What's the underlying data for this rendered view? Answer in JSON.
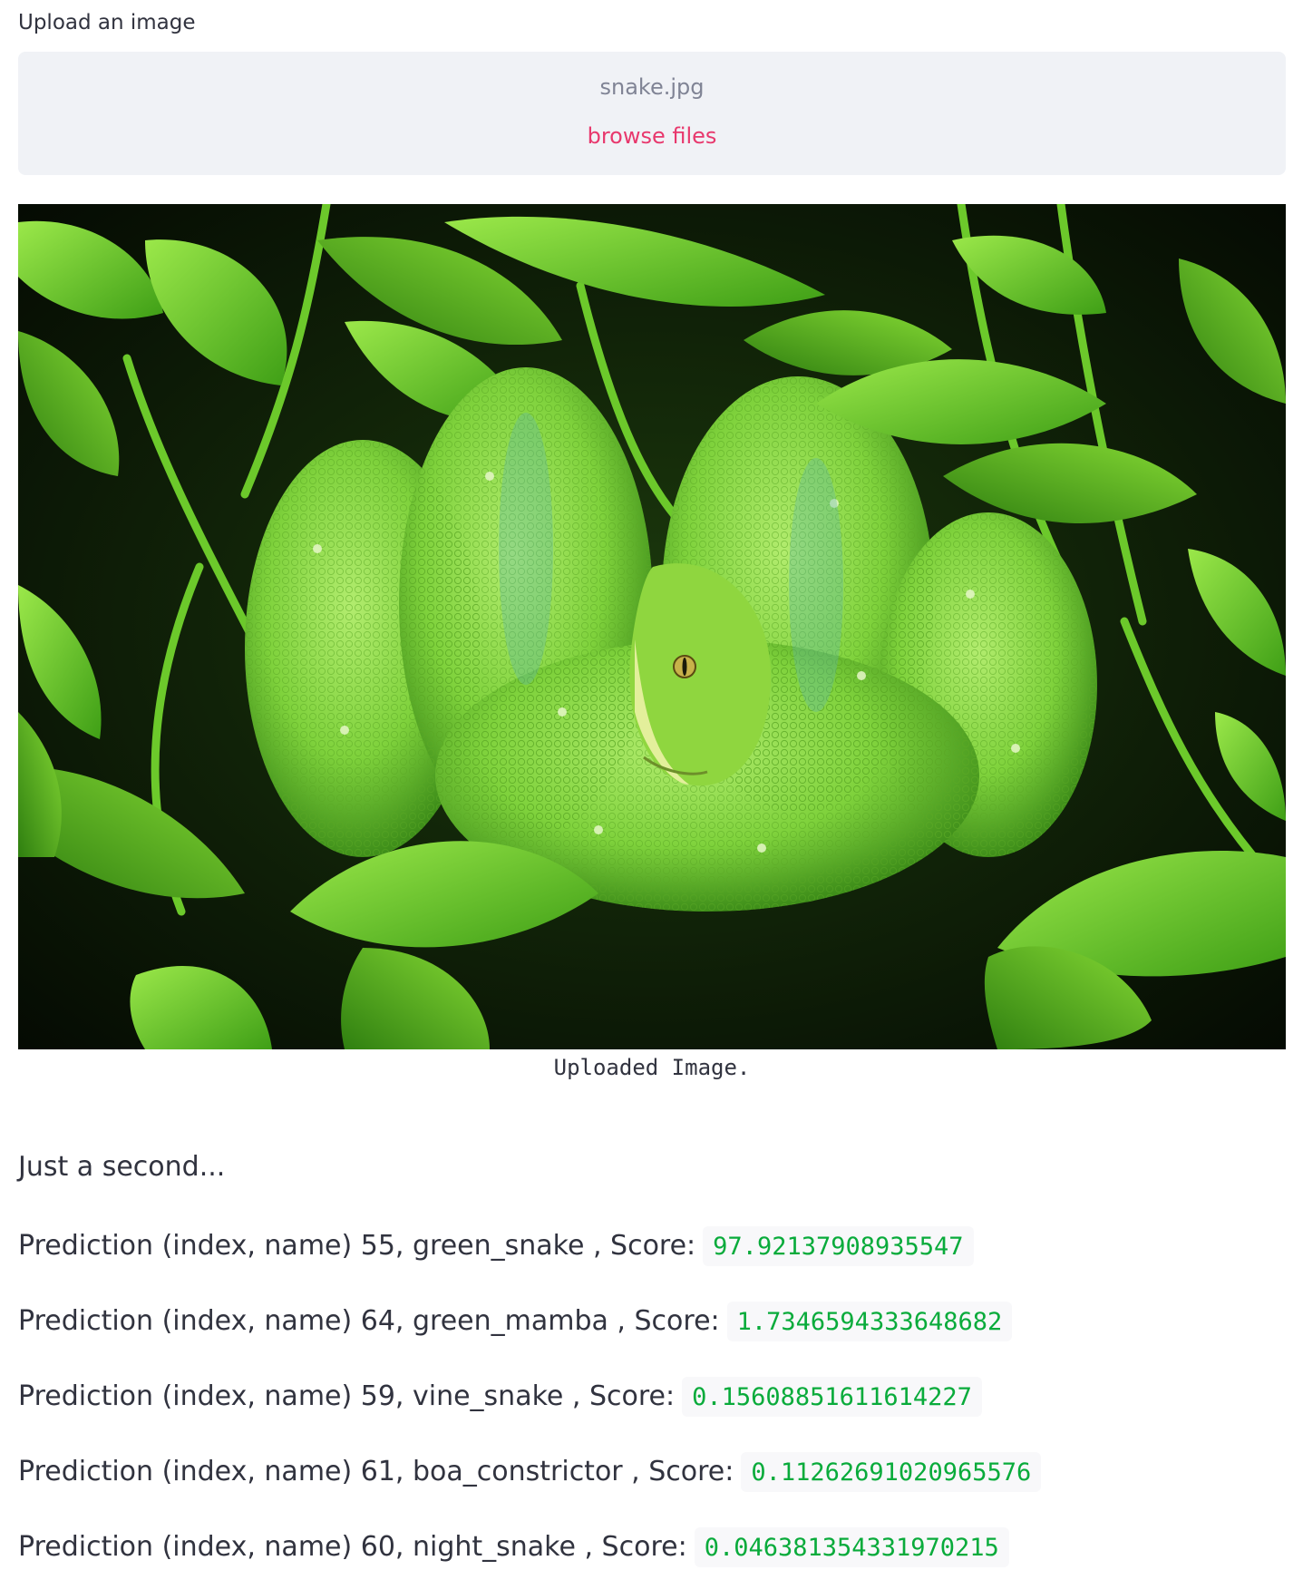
{
  "uploader": {
    "label": "Upload an image",
    "file_name": "snake.jpg",
    "browse_label": "browse files"
  },
  "image": {
    "caption": "Uploaded Image.",
    "colors": {
      "background": "#0b1607",
      "leaf": "#5fc91a",
      "leaf_light": "#8ee03a",
      "snake": "#7bd43a",
      "snake_light": "#a9e86a"
    }
  },
  "status_text": "Just a second...",
  "predictions": [
    {
      "text": "Prediction (index, name) 55, green_snake , Score:",
      "score": "97.92137908935547"
    },
    {
      "text": "Prediction (index, name) 64, green_mamba , Score:",
      "score": "1.7346594333648682"
    },
    {
      "text": "Prediction (index, name) 59, vine_snake , Score:",
      "score": "0.15608851611614227"
    },
    {
      "text": "Prediction (index, name) 61, boa_constrictor , Score:",
      "score": "0.11262691020965576"
    },
    {
      "text": "Prediction (index, name) 60, night_snake , Score:",
      "score": "0.046381354331970215"
    }
  ]
}
